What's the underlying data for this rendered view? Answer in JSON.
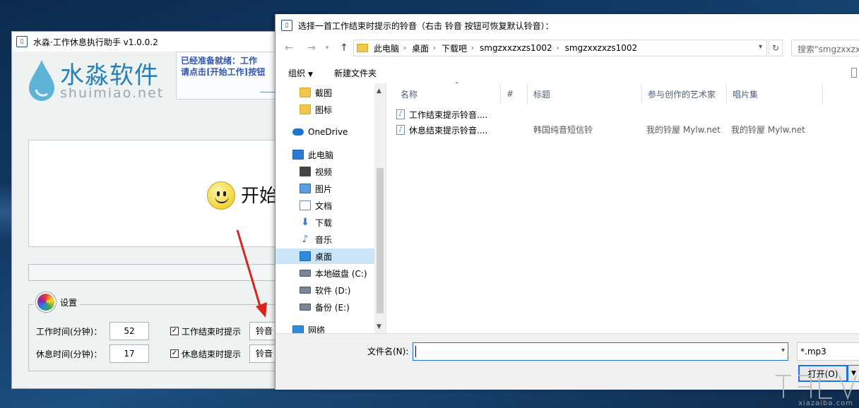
{
  "app": {
    "title": "水淼·工作休息执行助手 v1.0.0.2",
    "window_icon": "app-window-icon",
    "logo_text": "水淼软件",
    "logo_sub": "shuimiao.net",
    "status_line1": "已经准备就绪：工作",
    "status_line2": "请点击[开始工作]按钮",
    "start_text": "开始",
    "settings": {
      "label": "设置",
      "work_label": "工作时间(分钟)：",
      "work_value": "52",
      "rest_label": "休息时间(分钟)：",
      "rest_value": "17",
      "work_end_cb": "工作结束时提示",
      "rest_end_cb": "休息结束时提示",
      "ring_btn1": "铃音",
      "ring_btn2": "铃音",
      "check_mark": "✓"
    }
  },
  "dialog": {
    "title": "选择一首工作结束时提示的铃音（右击 铃音 按钮可恢复默认铃音）：",
    "breadcrumb": [
      "此电脑",
      "桌面",
      "下载吧",
      "smgzxxzxzs1002",
      "smgzxxzxzs1002"
    ],
    "search_placeholder": "搜索\"smgzxxzxzs1002\"",
    "toolbar": {
      "organize": "组织",
      "new_folder": "新建文件夹"
    },
    "nav": [
      {
        "label": "截图",
        "icon": "folder-icon"
      },
      {
        "label": "图标",
        "icon": "folder-icon"
      },
      {
        "label": "OneDrive",
        "icon": "cloud-icon"
      },
      {
        "label": "此电脑",
        "icon": "computer-icon"
      },
      {
        "label": "视频",
        "icon": "video-icon"
      },
      {
        "label": "图片",
        "icon": "picture-icon"
      },
      {
        "label": "文档",
        "icon": "document-icon"
      },
      {
        "label": "下载",
        "icon": "download-icon"
      },
      {
        "label": "音乐",
        "icon": "music-icon"
      },
      {
        "label": "桌面",
        "icon": "desktop-icon"
      },
      {
        "label": "本地磁盘 (C:)",
        "icon": "disk-icon"
      },
      {
        "label": "软件 (D:)",
        "icon": "disk-icon"
      },
      {
        "label": "备份 (E:)",
        "icon": "disk-icon"
      },
      {
        "label": "网络",
        "icon": "network-icon"
      }
    ],
    "columns": [
      "名称",
      "#",
      "标题",
      "参与创作的艺术家",
      "唱片集"
    ],
    "files": [
      {
        "name": "工作结束提示铃音....",
        "number": "",
        "title": "",
        "artist": "",
        "album": ""
      },
      {
        "name": "休息结束提示铃音....",
        "number": "",
        "title": "韩国纯音短信铃",
        "artist": "我的铃屋 Mylw.net",
        "album": "我的铃屋 Mylw.net"
      }
    ],
    "filename_label": "文件名(N):",
    "filename_value": "",
    "filetype": "*.mp3",
    "open_button": "打开(O)"
  },
  "watermark": {
    "text": "xiazaiba.com"
  },
  "colors": {
    "accent": "#1a73e8",
    "selected": "#cce4f7",
    "status_text": "#3355b2"
  }
}
